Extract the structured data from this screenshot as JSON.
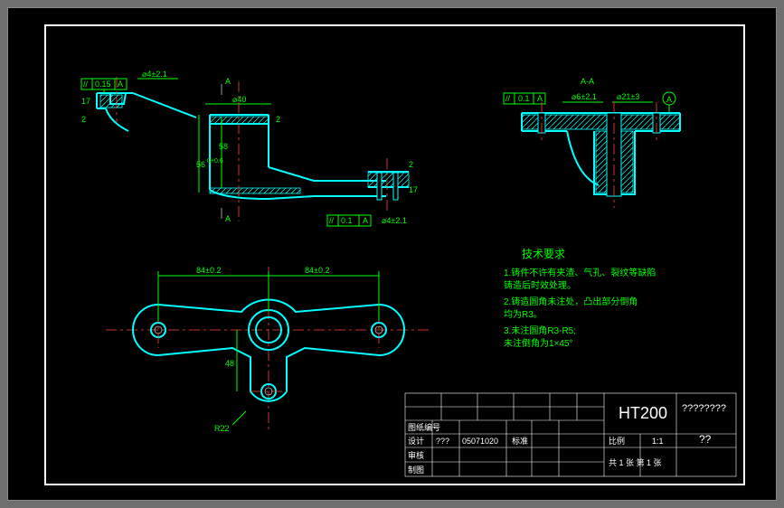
{
  "dimensions": {
    "top_view": {
      "tol_015": "0.15",
      "dia4_21_1": "⌀4±2.1",
      "dia40": "⌀40",
      "d17": "17",
      "d2_1": "2",
      "d2_2": "2",
      "d58": "58",
      "d56": "56",
      "tol56": "0+0.6",
      "d17b": "17",
      "d2_3": "2",
      "a_top": "A",
      "a_bot": "A",
      "tol_01": "0.1",
      "dia4_21_2": "⌀4±2.1",
      "a_ref": "A"
    },
    "section": {
      "aa_label": "A-A",
      "tol_01": "0.1",
      "dia6_21": "⌀6±2.1",
      "dia21_3": "⌀21±3",
      "a_datum": "A"
    },
    "bottom_view": {
      "d84_1": "84±0.2",
      "d84_2": "84±0.2",
      "d48": "48",
      "r22": "R22"
    }
  },
  "tech_req": {
    "title": "技术要求",
    "line1": "1.铸件不许有夹渣、气孔、裂纹等缺陷",
    "line2": "铸造后时效处理。",
    "line3": "2.铸造圆角未注处，凸出部分倒角",
    "line4": "均为R3。",
    "line5": "3.未注圆角R3-R5;",
    "line6": "未注倒角为1×45°"
  },
  "title_block": {
    "material": "HT200",
    "part_name": "????????",
    "qty": "??",
    "rev": "图纸编号",
    "design": "设计",
    "designer": "???",
    "date": "05071020",
    "checked": "审核",
    "drawn": "制图",
    "scale_label": "比例",
    "scale": "1:1",
    "sheet": "共 1 张 第 1 张",
    "approved": "标准"
  }
}
